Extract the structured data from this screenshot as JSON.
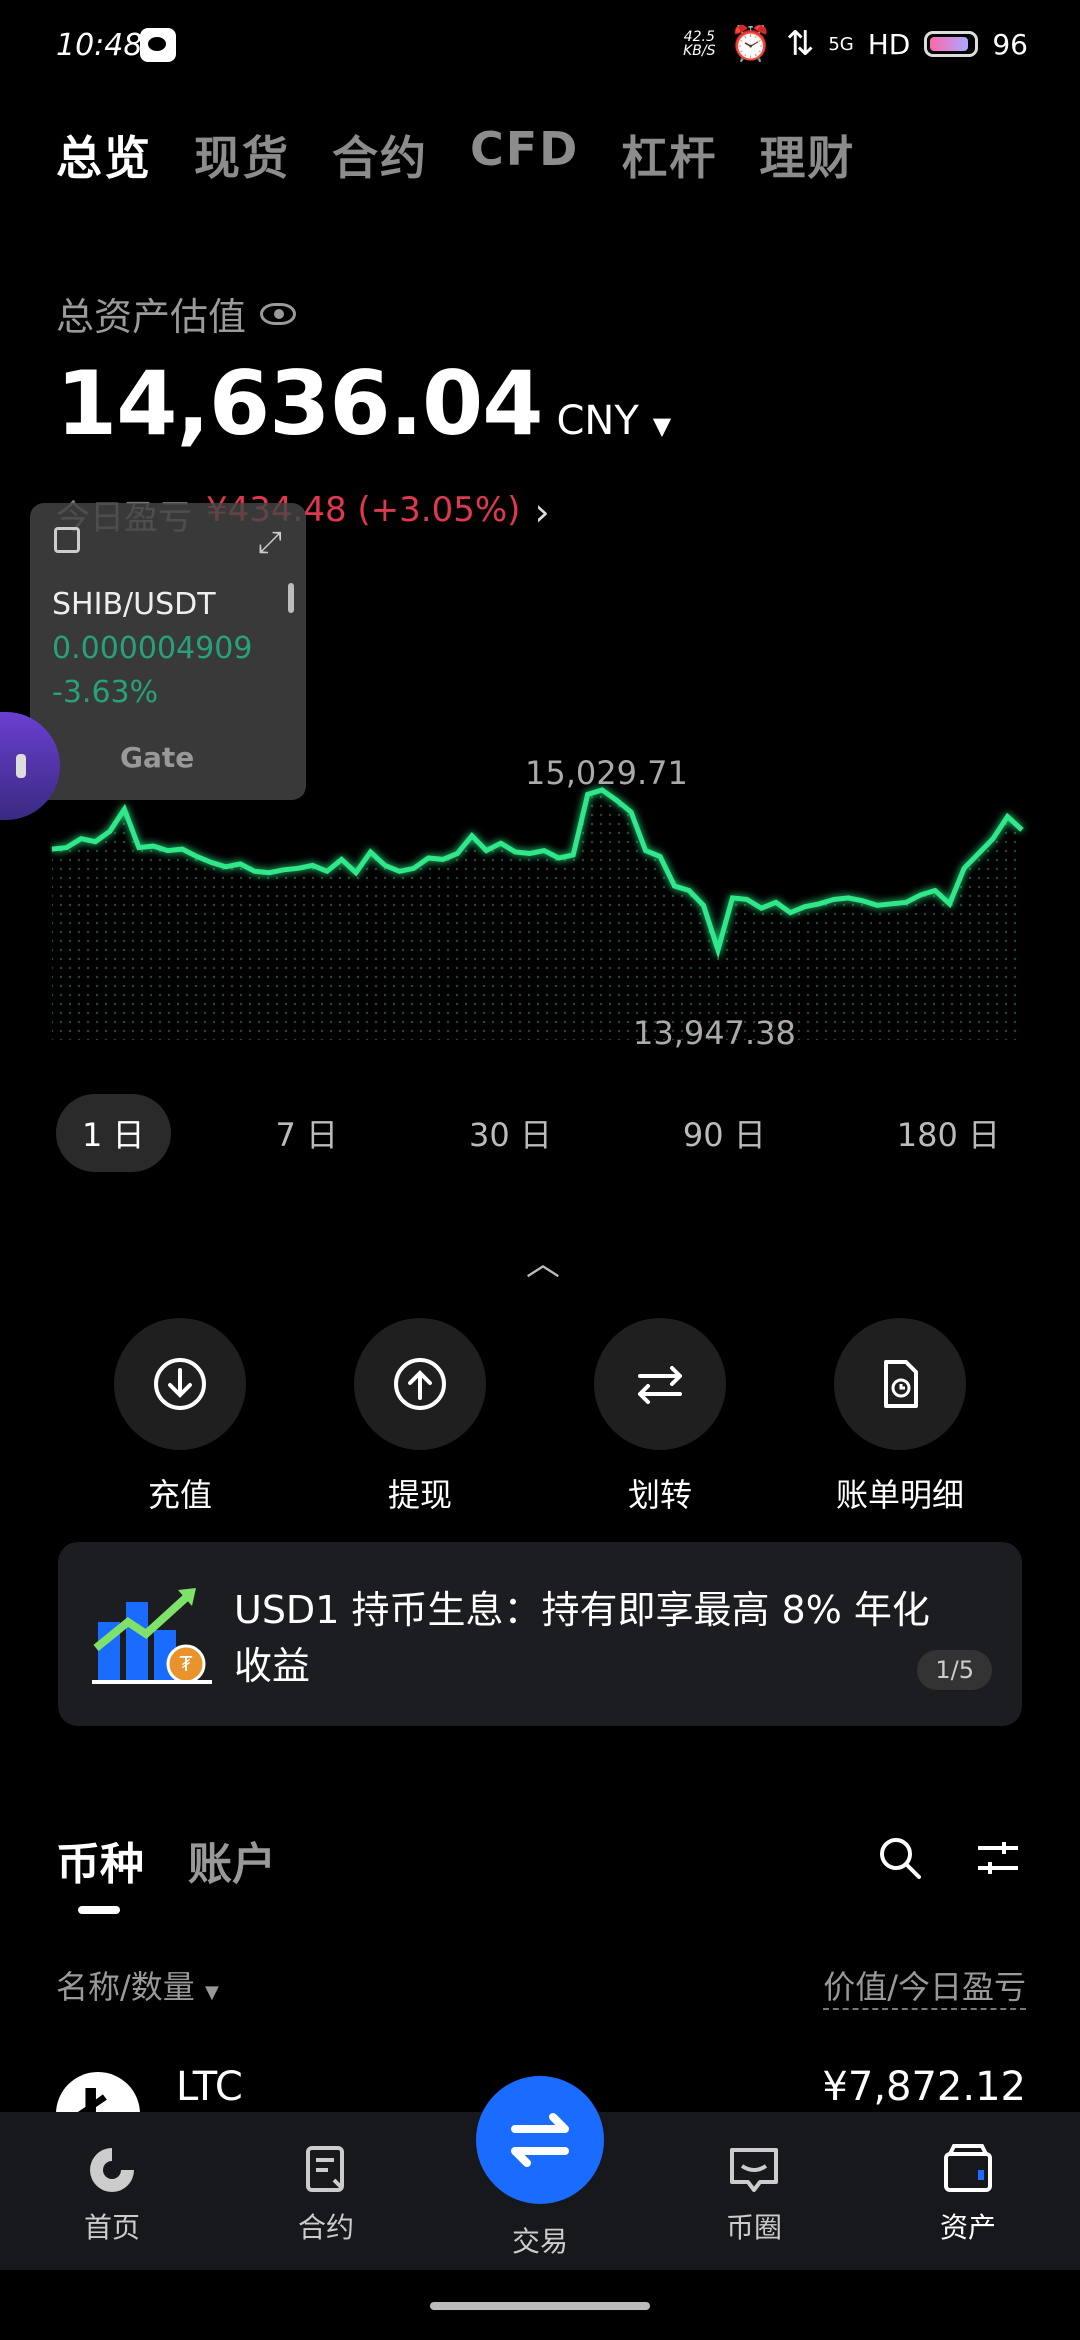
{
  "status_bar": {
    "time": "10:48",
    "net_speed_value": "42.5",
    "net_speed_unit": "KB/S",
    "network": "5G",
    "hd": "HD",
    "battery": "96"
  },
  "top_tabs": [
    "总览",
    "现货",
    "合约",
    "CFD",
    "杠杆",
    "理财"
  ],
  "assets": {
    "label": "总资产估值",
    "total": "14,636.04",
    "currency": "CNY",
    "pnl_label": "今日盈亏",
    "pnl_value": "¥434.48 (+3.05%)"
  },
  "widget": {
    "pair": "SHIB/USDT",
    "price": "0.000004909",
    "change": "-3.63%",
    "brand": "Gate"
  },
  "chart_data": {
    "type": "line",
    "high_label": "15,029.71",
    "low_label": "13,947.38",
    "y": [
      14630,
      14640,
      14700,
      14680,
      14750,
      14900,
      14640,
      14650,
      14620,
      14630,
      14580,
      14540,
      14510,
      14530,
      14480,
      14470,
      14490,
      14500,
      14520,
      14480,
      14560,
      14470,
      14610,
      14520,
      14480,
      14500,
      14570,
      14560,
      14600,
      14720,
      14620,
      14670,
      14610,
      14600,
      14620,
      14570,
      14590,
      15000,
      15029.71,
      14960,
      14880,
      14620,
      14580,
      14380,
      14350,
      14250,
      13947.38,
      14300,
      14290,
      14230,
      14270,
      14200,
      14240,
      14260,
      14290,
      14300,
      14280,
      14250,
      14260,
      14270,
      14320,
      14350,
      14260,
      14500,
      14600,
      14700,
      14850,
      14760
    ],
    "colors": {
      "line": "#2ee88a",
      "grid": "#1b3a2a"
    }
  },
  "ranges": [
    "1 日",
    "7 日",
    "30 日",
    "90 日",
    "180 日"
  ],
  "actions": [
    {
      "label": "充值",
      "icon": "deposit-icon"
    },
    {
      "label": "提现",
      "icon": "withdraw-icon"
    },
    {
      "label": "划转",
      "icon": "transfer-icon"
    },
    {
      "label": "账单明细",
      "icon": "bill-icon"
    }
  ],
  "banner": {
    "text": "USD1 持币生息：持有即享最高 8% 年化收益",
    "pager": "1/5"
  },
  "coin_tabs": [
    "币种",
    "账户"
  ],
  "list_header": {
    "left": "名称/数量",
    "right": "价值/今日盈亏"
  },
  "coins": [
    {
      "symbol": "LTC",
      "value": "¥7,872.12"
    }
  ],
  "bottom_nav": [
    "首页",
    "合约",
    "交易",
    "币圈",
    "资产"
  ]
}
